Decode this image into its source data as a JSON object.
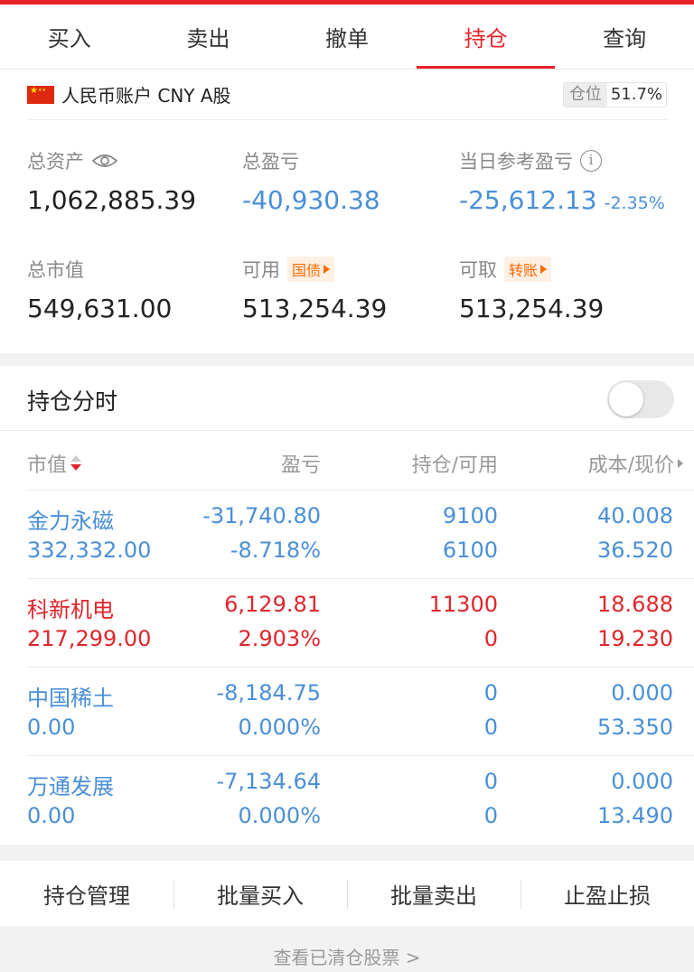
{
  "tabs": [
    {
      "label": "买入"
    },
    {
      "label": "卖出"
    },
    {
      "label": "撤单"
    },
    {
      "label": "持仓",
      "active": true
    },
    {
      "label": "查询"
    }
  ],
  "account": {
    "name": "人民币账户 CNY A股",
    "position_label": "仓位",
    "position_value": "51.7%",
    "total_assets_label": "总资产",
    "total_assets": "1,062,885.39",
    "total_pl_label": "总盈亏",
    "total_pl": "-40,930.38",
    "daily_pl_label": "当日参考盈亏",
    "daily_pl": "-25,612.13",
    "daily_pl_pct": "-2.35%",
    "market_value_label": "总市值",
    "market_value": "549,631.00",
    "available_label": "可用",
    "available_tag": "国债",
    "available": "513,254.39",
    "withdrawable_label": "可取",
    "withdrawable_tag": "转账",
    "withdrawable": "513,254.39"
  },
  "holdings": {
    "title": "持仓分时",
    "toggle_on": false,
    "columns": {
      "market_value": "市值",
      "pl": "盈亏",
      "qty": "持仓/可用",
      "cost": "成本/现价"
    },
    "rows": [
      {
        "name": "金力永磁",
        "market_value": "332,332.00",
        "pl": "-31,740.80",
        "pl_pct": "-8.718%",
        "qty": "9100",
        "available": "6100",
        "cost": "40.008",
        "price": "36.520",
        "color": "blue"
      },
      {
        "name": "科新机电",
        "market_value": "217,299.00",
        "pl": "6,129.81",
        "pl_pct": "2.903%",
        "qty": "11300",
        "available": "0",
        "cost": "18.688",
        "price": "19.230",
        "color": "red"
      },
      {
        "name": "中国稀土",
        "market_value": "0.00",
        "pl": "-8,184.75",
        "pl_pct": "0.000%",
        "qty": "0",
        "available": "0",
        "cost": "0.000",
        "price": "53.350",
        "color": "blue"
      },
      {
        "name": "万通发展",
        "market_value": "0.00",
        "pl": "-7,134.64",
        "pl_pct": "0.000%",
        "qty": "0",
        "available": "0",
        "cost": "0.000",
        "price": "13.490",
        "color": "blue"
      }
    ]
  },
  "actions": [
    {
      "label": "持仓管理"
    },
    {
      "label": "批量买入"
    },
    {
      "label": "批量卖出"
    },
    {
      "label": "止盈止损"
    }
  ],
  "cleared_link": "查看已清仓股票 >",
  "colors": {
    "accent": "#e8222a",
    "loss": "#4a8fd8",
    "gain": "#e0262b",
    "tag": "#ff6a00"
  },
  "icons": [
    "eye-icon",
    "info-icon",
    "sort-icon",
    "next-icon",
    "flag-cn-icon"
  ]
}
